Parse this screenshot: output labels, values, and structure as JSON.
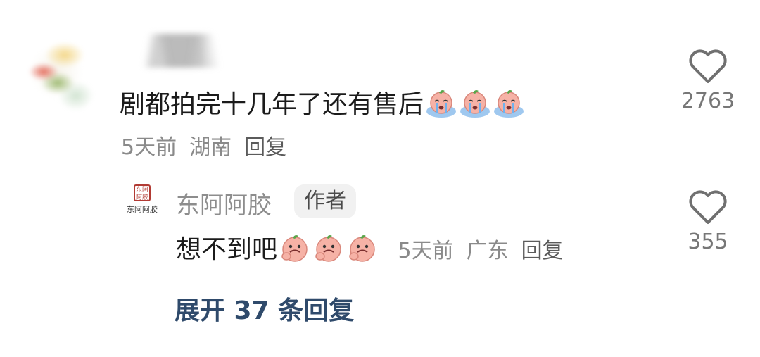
{
  "comment": {
    "text": "剧都拍完十几年了还有售后",
    "emojis": [
      "crying-peach-emoji",
      "crying-peach-emoji",
      "crying-peach-emoji"
    ],
    "time": "5天前",
    "location": "湖南",
    "reply_label": "回复",
    "likes": "2763"
  },
  "reply": {
    "avatar_caption": "东阿阿胶",
    "seal_text": "东阿阿胶",
    "name": "东阿阿胶",
    "badge": "作者",
    "text": "想不到吧",
    "emojis": [
      "smirk-peach-emoji",
      "smirk-peach-emoji",
      "smirk-peach-emoji"
    ],
    "time": "5天前",
    "location": "广东",
    "reply_label": "回复",
    "likes": "355"
  },
  "expand_label": "展开 37 条回复",
  "colors": {
    "text": "#1b1b1b",
    "meta": "#8a8a8a",
    "expand": "#2f4a6b",
    "peach": "#f4a39a"
  }
}
